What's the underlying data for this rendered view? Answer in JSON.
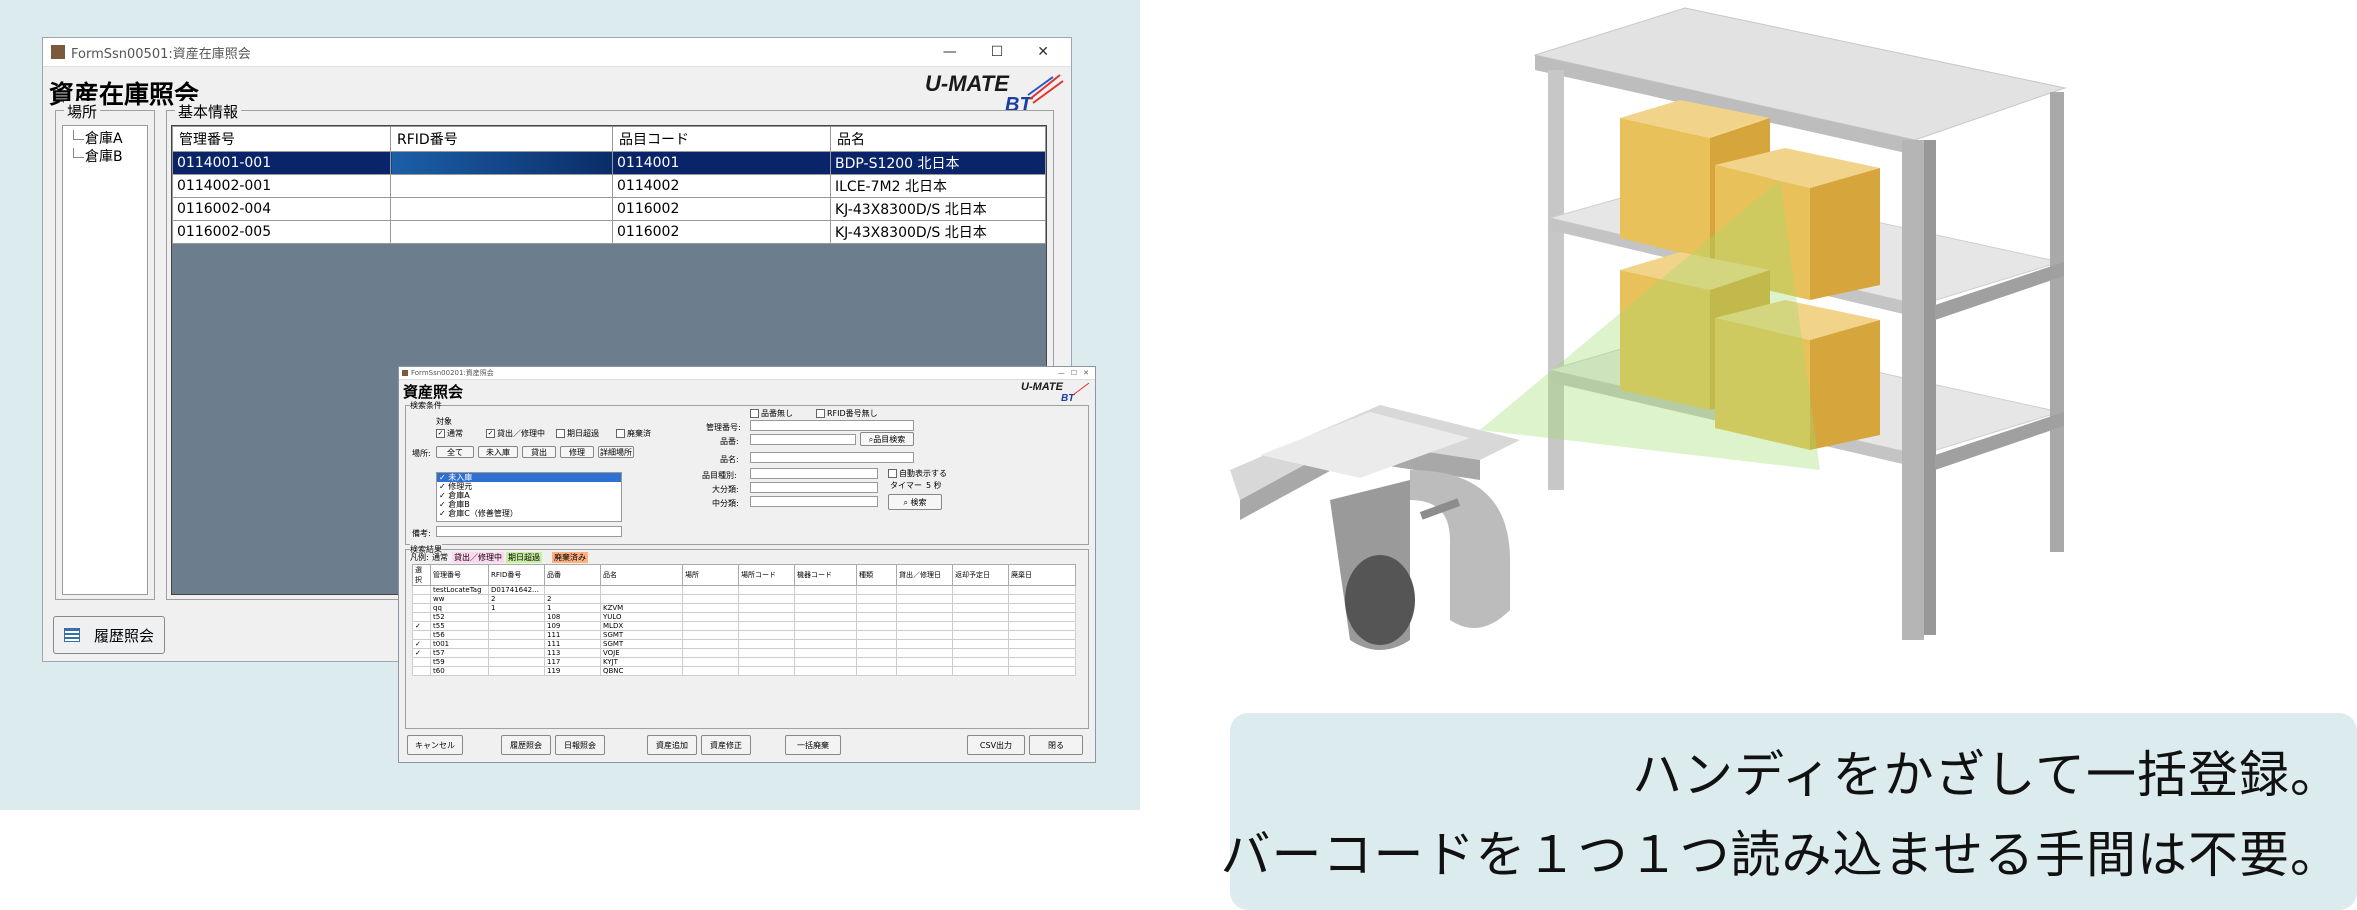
{
  "main_window": {
    "title": "FormSsn00501:資産在庫照会",
    "heading": "資産在庫照会",
    "controls": {
      "minimize": "—",
      "maximize": "☐",
      "close": "✕"
    },
    "logo_text": "U-MATE",
    "logo_sub": "BT",
    "location_label": "場所",
    "locations": [
      "倉庫A",
      "倉庫B"
    ],
    "info_label": "基本情報",
    "columns": [
      "管理番号",
      "RFID番号",
      "品目コード",
      "品名"
    ],
    "rows": [
      [
        "0114001-001",
        "",
        "0114001",
        "BDP-S1200 北日本"
      ],
      [
        "0114002-001",
        "",
        "0114002",
        "ILCE-7M2 北日本"
      ],
      [
        "0116002-004",
        "",
        "0116002",
        "KJ-43X8300D/S 北日本"
      ],
      [
        "0116002-005",
        "",
        "0116002",
        "KJ-43X8300D/S 北日本"
      ]
    ],
    "history_button": "履歴照会"
  },
  "sub_window": {
    "title": "FormSsn00201:資産照会",
    "heading": "資産照会",
    "logo_text": "U-MATE",
    "logo_sub": "BT",
    "search_group": "検索条件",
    "target_label": "対象",
    "target_checks": [
      "通常",
      "貸出／修理中",
      "期日超過",
      "廃棄済"
    ],
    "location_label": "場所:",
    "location_buttons": [
      "全て",
      "未入庫",
      "貸出",
      "修理",
      "詳細場所"
    ],
    "location_list": [
      "未入庫",
      "修理元",
      "倉庫A",
      "倉庫B",
      "倉庫C（修善管理）"
    ],
    "remarks_label": "備考:",
    "no_item_check": "品番無し",
    "no_rfid_check": "RFID番号無し",
    "manage_no_label": "管理番号:",
    "item_no_label": "品番:",
    "item_search_button": "品目検索",
    "item_name_label": "品名:",
    "item_type_label": "品目種別:",
    "major_label": "大分類:",
    "minor_label": "中分類:",
    "auto_display": "自動表示する",
    "timer_label": "タイマー",
    "timer_value": "5 秒",
    "search_button": "検索",
    "result_group": "検索結果",
    "legend_label": "凡例:",
    "legend_items": [
      {
        "label": "通常",
        "color": "#ffffff"
      },
      {
        "label": "貸出／修理中",
        "color": "#ffd6f0"
      },
      {
        "label": "期日超過",
        "color": "#c8f0a0"
      },
      {
        "label": "廃棄済み",
        "color": "#ffb080"
      }
    ],
    "result_columns": [
      "選択",
      "管理番号",
      "RFID番号",
      "品番",
      "品名",
      "場所",
      "場所コード",
      "機器コード",
      "種類",
      "貸出／修理日",
      "返却予定日",
      "廃棄日"
    ],
    "result_rows": [
      [
        "",
        "testLocateTag",
        "D01741642…",
        "",
        "",
        "",
        "",
        "",
        "",
        "",
        "",
        ""
      ],
      [
        "",
        "ww",
        "2",
        "2",
        "",
        "",
        "",
        "",
        "",
        "",
        "",
        ""
      ],
      [
        "",
        "qq",
        "1",
        "1",
        "KZVM",
        "",
        "",
        "",
        "",
        "",
        "",
        ""
      ],
      [
        "",
        "t52",
        "",
        "108",
        "YULO",
        "",
        "",
        "",
        "",
        "",
        "",
        ""
      ],
      [
        "✓",
        "t55",
        "",
        "109",
        "MLDX",
        "",
        "",
        "",
        "",
        "",
        "",
        ""
      ],
      [
        "",
        "t56",
        "",
        "111",
        "SGMT",
        "",
        "",
        "",
        "",
        "",
        "",
        ""
      ],
      [
        "✓",
        "t001",
        "",
        "111",
        "SGMT",
        "",
        "",
        "",
        "",
        "",
        "",
        ""
      ],
      [
        "✓",
        "t57",
        "",
        "113",
        "VOJE",
        "",
        "",
        "",
        "",
        "",
        "",
        ""
      ],
      [
        "",
        "t59",
        "",
        "117",
        "KYJT",
        "",
        "",
        "",
        "",
        "",
        "",
        ""
      ],
      [
        "",
        "t60",
        "",
        "119",
        "QBNC",
        "",
        "",
        "",
        "",
        "",
        "",
        ""
      ]
    ],
    "bottom_buttons": [
      "キャンセル",
      "履歴照会",
      "日報照会",
      "資産追加",
      "資産修正",
      "一括廃棄",
      "CSV出力",
      "閉る"
    ]
  },
  "caption": {
    "line1": "ハンディをかざして一括登録。",
    "line2": "バーコードを１つ１つ読み込ませる手間は不要。"
  },
  "colors": {
    "panel_bg": "#dcebee",
    "grid_bg": "#6c7e8d",
    "selected_row": "#0a246a",
    "box": "#e8c15a",
    "shelf": "#d4d4d4",
    "beam": "#9fdc6b"
  }
}
